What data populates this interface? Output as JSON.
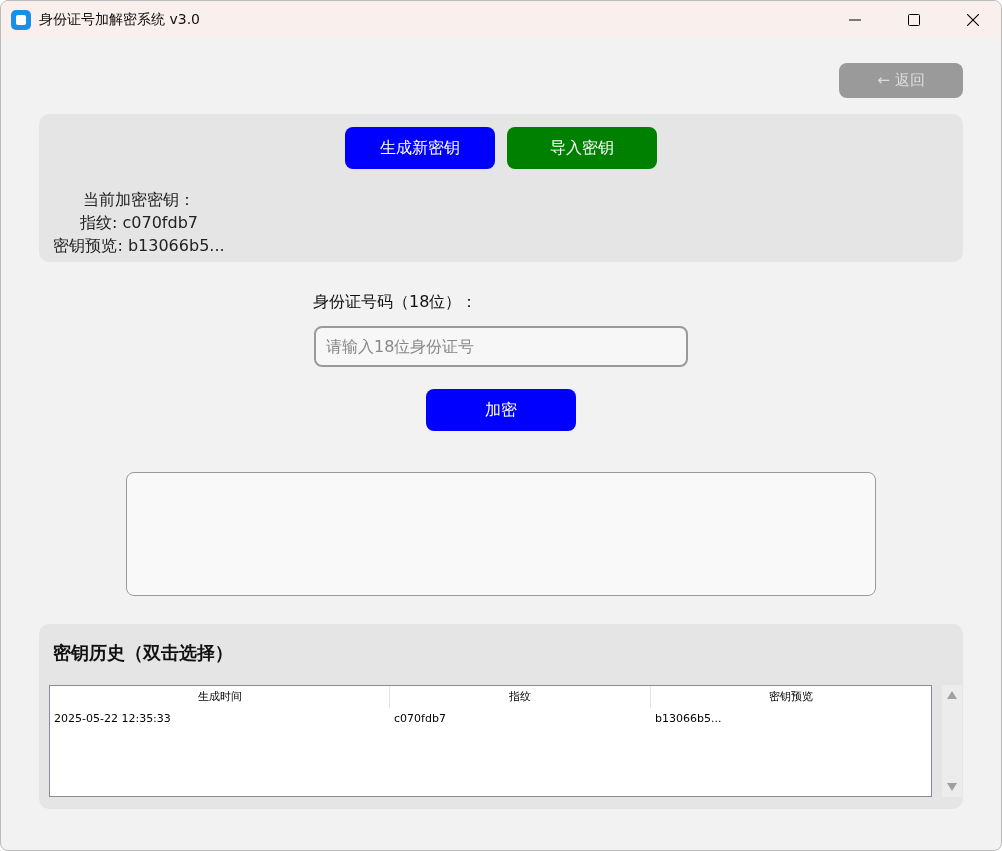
{
  "window": {
    "title": "身份证号加解密系统 v3.0"
  },
  "back_button": {
    "label": "← 返回"
  },
  "key_panel": {
    "buttons": [
      {
        "label": "生成新密钥",
        "color": "#0000ff"
      },
      {
        "label": "导入密钥",
        "color": "#008000"
      }
    ],
    "current_key_lines": [
      "当前加密密钥：",
      "指纹: c070fdb7",
      "密钥预览: b13066b5..."
    ]
  },
  "id_field": {
    "label": "身份证号码（18位）：",
    "placeholder": "请输入18位身份证号"
  },
  "encrypt_button": {
    "label": "加密"
  },
  "history": {
    "title": "密钥历史（双击选择）",
    "columns": [
      "生成时间",
      "指纹",
      "密钥预览"
    ],
    "rows": [
      [
        "2025-05-22 12:35:33",
        "c070fdb7",
        "b13066b5..."
      ]
    ]
  }
}
